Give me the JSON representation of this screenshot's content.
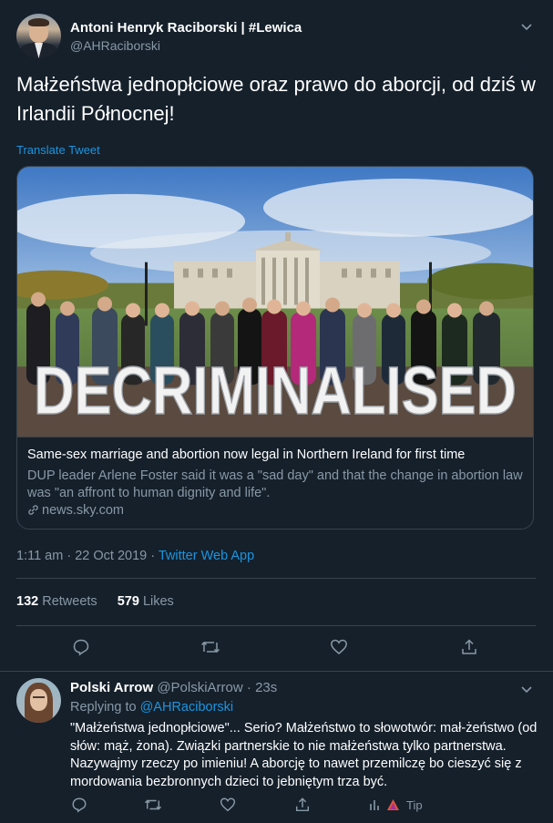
{
  "tweet": {
    "author_name": "Antoni Henryk Raciborski | #Lewica",
    "author_handle": "@AHRaciborski",
    "text": "Małżeństwa jednopłciowe oraz prawo do aborcji, od dziś w Irlandii Północnej!",
    "translate_label": "Translate Tweet",
    "card": {
      "image_sign": "DECRIMINALISED",
      "title": "Same-sex marriage and abortion now legal in Northern Ireland for first time",
      "description": "DUP leader Arlene Foster said it was a \"sad day\" and that the change in abortion law was \"an affront to human dignity and life\".",
      "domain": "news.sky.com"
    },
    "time": "1:11 am · 22 Oct 2019",
    "dot": "·",
    "app": "Twitter Web App",
    "retweets_count": "132",
    "retweets_label": "Retweets",
    "likes_count": "579",
    "likes_label": "Likes",
    "actions": [
      "reply-icon",
      "retweet-icon",
      "like-icon",
      "share-icon"
    ]
  },
  "reply": {
    "author_name": "Polski Arrow",
    "author_handle": "@PolskiArrow",
    "time": "· 23s",
    "replying_to_label": "Replying to",
    "replying_to_handle": "@AHRaciborski",
    "text": "\"Małżeństwa jednopłciowe\"... Serio? Małżeństwo to słowotwór: mał-żeństwo (od słów: mąż, żona). Związki partnerskie to nie małżeństwa tylko partnerstwa. Nazywajmy rzeczy po imieniu! A aborcję to nawet przemilczę bo cieszyć się z mordowania bezbronnych dzieci to jebniętym trza być.",
    "tip_label": "Tip"
  },
  "colors": {
    "background": "#15202b",
    "accent": "#1b95e0",
    "muted": "#8899a6",
    "border": "#38444d"
  }
}
